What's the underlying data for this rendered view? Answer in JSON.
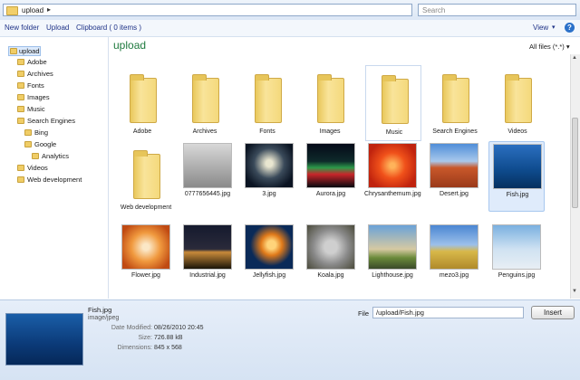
{
  "address": {
    "path": "upload",
    "arrow": "▸"
  },
  "search": {
    "placeholder": "Search"
  },
  "toolbar": {
    "new_folder": "New folder",
    "upload": "Upload",
    "clipboard": "Clipboard ( 0 items )",
    "view": "View",
    "view_arrow": "▾",
    "help": "?"
  },
  "tree": {
    "root": "upload",
    "items": [
      {
        "label": "Adobe"
      },
      {
        "label": "Archives"
      },
      {
        "label": "Fonts"
      },
      {
        "label": "Images"
      },
      {
        "label": "Music"
      },
      {
        "label": "Search Engines"
      },
      {
        "label": "Bing"
      },
      {
        "label": "Google"
      },
      {
        "label": "Analytics"
      },
      {
        "label": "Videos"
      },
      {
        "label": "Web development"
      }
    ]
  },
  "main": {
    "title": "upload",
    "filter": "All files (*.*) ▾",
    "folders": [
      {
        "label": "Adobe"
      },
      {
        "label": "Archives"
      },
      {
        "label": "Fonts"
      },
      {
        "label": "Images"
      },
      {
        "label": "Music"
      },
      {
        "label": "Search Engines"
      },
      {
        "label": "Videos"
      },
      {
        "label": "Web development"
      }
    ],
    "files": [
      {
        "label": "0777656445.jpg"
      },
      {
        "label": "3.jpg"
      },
      {
        "label": "Aurora.jpg"
      },
      {
        "label": "Chrysanthemum.jpg"
      },
      {
        "label": "Desert.jpg"
      },
      {
        "label": "Fish.jpg"
      },
      {
        "label": "Flower.jpg"
      },
      {
        "label": "Industrial.jpg"
      },
      {
        "label": "Jellyfish.jpg"
      },
      {
        "label": "Koala.jpg"
      },
      {
        "label": "Lighthouse.jpg"
      },
      {
        "label": "mezo3.jpg"
      },
      {
        "label": "Penguins.jpg"
      }
    ]
  },
  "info": {
    "name": "Fish.jpg",
    "type": "image/jpeg",
    "date_label": "Date Modified:",
    "date_value": "08/26/2010 20:45",
    "size_label": "Size:",
    "size_value": "726.88 kB",
    "dim_label": "Dimensions:",
    "dim_value": "845 x 568",
    "file_label": "File",
    "file_value": "/upload/Fish.jpg",
    "insert": "Insert"
  },
  "scrollbar": {
    "up": "▲",
    "down": "▼"
  },
  "colors": {
    "accent_title": "#1e7a3e",
    "link": "#1e3287",
    "selection": "#dfebfb"
  }
}
